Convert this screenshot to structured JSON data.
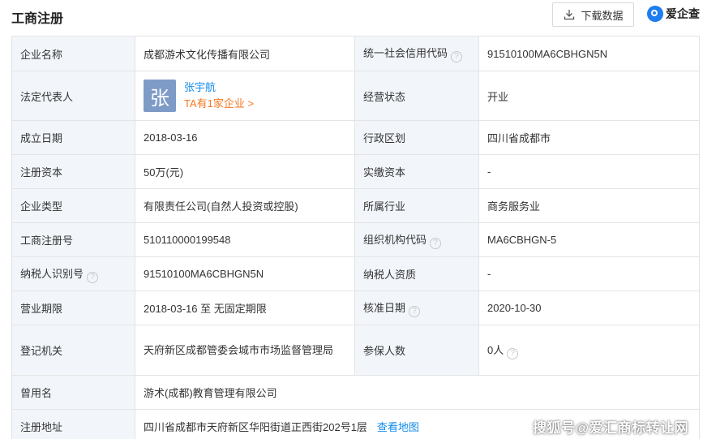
{
  "header": {
    "title": "工商注册",
    "download_label": "下载数据",
    "brand_text": "爱企查"
  },
  "fields": {
    "company_name_label": "企业名称",
    "company_name": "成都游术文化传播有限公司",
    "credit_code_label": "统一社会信用代码",
    "credit_code": "91510100MA6CBHGN5N",
    "legal_rep_label": "法定代表人",
    "avatar_char": "张",
    "legal_rep_name": "张宇航",
    "legal_rep_count": "TA有1家企业 >",
    "status_label": "经营状态",
    "status": "开业",
    "founded_label": "成立日期",
    "founded": "2018-03-16",
    "region_label": "行政区划",
    "region": "四川省成都市",
    "reg_capital_label": "注册资本",
    "reg_capital": "50万(元)",
    "paid_capital_label": "实缴资本",
    "paid_capital": "-",
    "type_label": "企业类型",
    "type": "有限责任公司(自然人投资或控股)",
    "industry_label": "所属行业",
    "industry": "商务服务业",
    "reg_no_label": "工商注册号",
    "reg_no": "510110000199548",
    "org_code_label": "组织机构代码",
    "org_code": "MA6CBHGN-5",
    "taxpayer_id_label": "纳税人识别号",
    "taxpayer_id": "91510100MA6CBHGN5N",
    "taxpayer_qual_label": "纳税人资质",
    "taxpayer_qual": "-",
    "term_label": "营业期限",
    "term": "2018-03-16 至 无固定期限",
    "approval_label": "核准日期",
    "approval": "2020-10-30",
    "authority_label": "登记机关",
    "authority": "天府新区成都管委会城市市场监督管理局",
    "insured_label": "参保人数",
    "insured": "0人",
    "former_name_label": "曾用名",
    "former_name": "游术(成都)教育管理有限公司",
    "address_label": "注册地址",
    "address": "四川省成都市天府新区华阳街道正西街202号1层",
    "map_link": "查看地图"
  },
  "watermark": "搜狐号@爱汇商标转让网"
}
